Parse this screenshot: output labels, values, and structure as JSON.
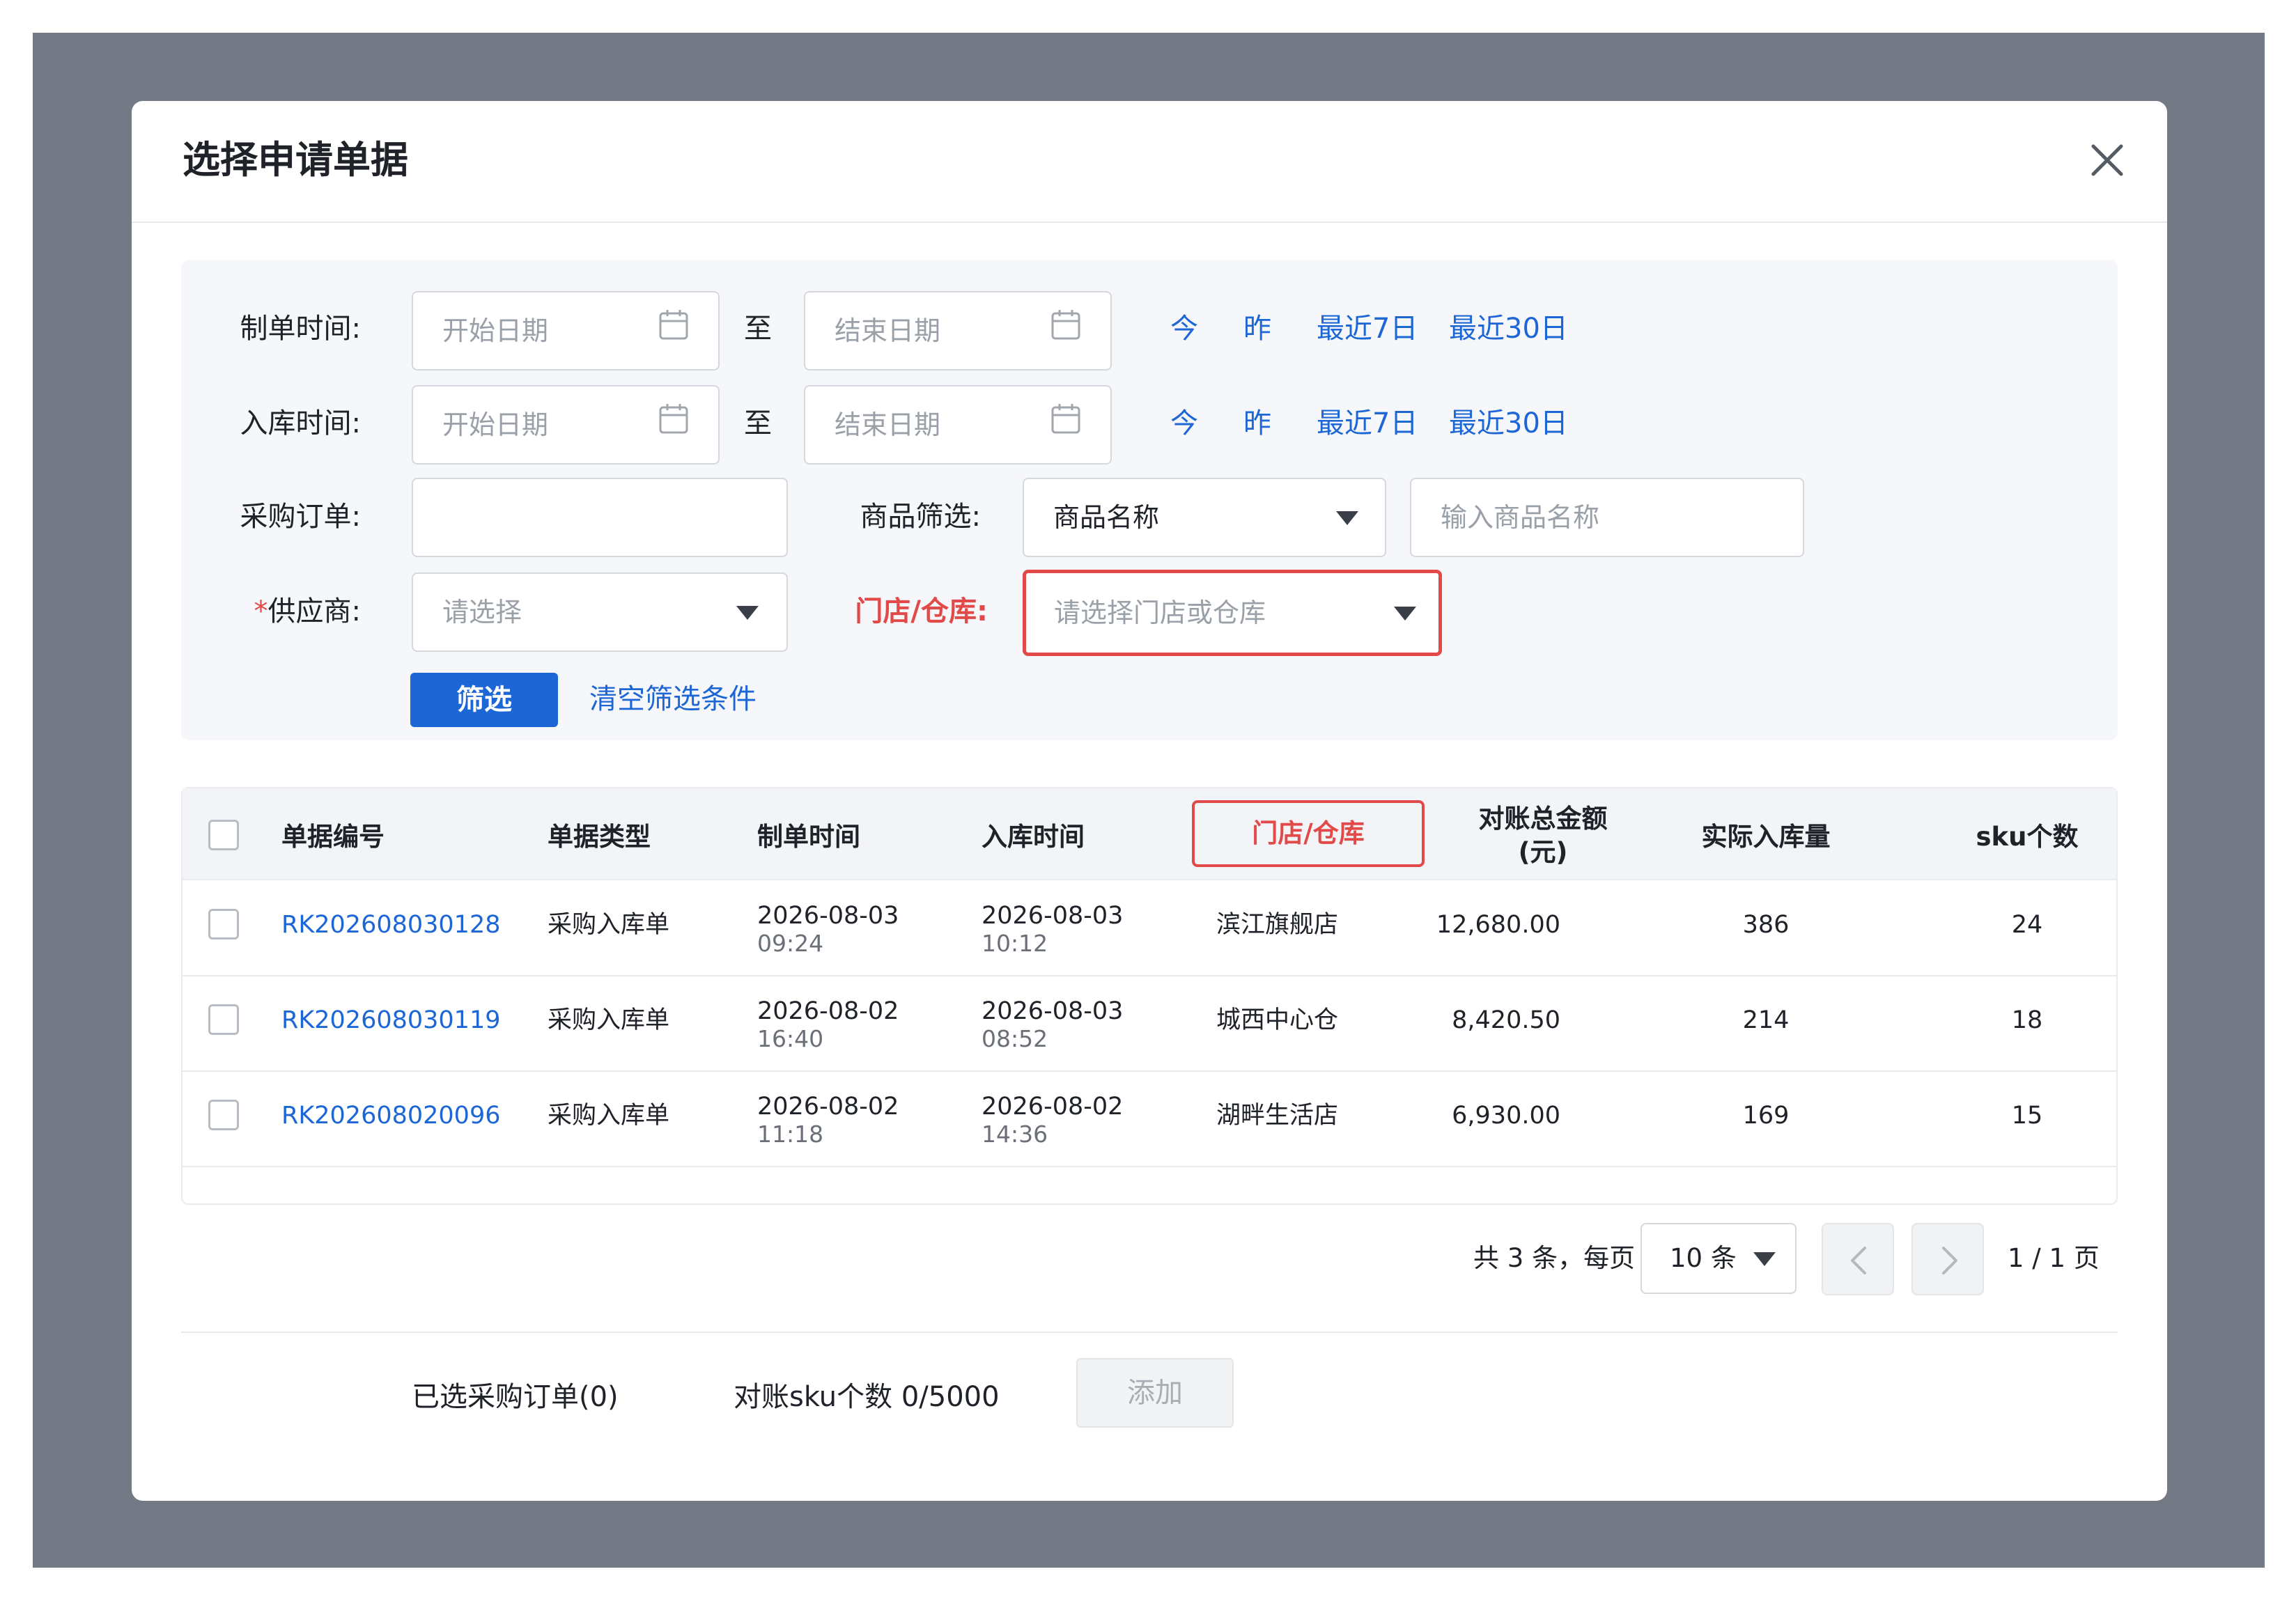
{
  "modal": {
    "title": "选择申请单据"
  },
  "filters": {
    "create_time": {
      "label": "制单时间:",
      "start_placeholder": "开始日期",
      "separator": "至",
      "end_placeholder": "结束日期",
      "quick": [
        "今",
        "昨",
        "最近7日",
        "最近30日"
      ]
    },
    "stock_time": {
      "label": "入库时间:",
      "start_placeholder": "开始日期",
      "separator": "至",
      "end_placeholder": "结束日期",
      "quick": [
        "今",
        "昨",
        "最近7日",
        "最近30日"
      ]
    },
    "purchase_order": {
      "label": "采购订单:",
      "value": ""
    },
    "product_filter": {
      "label": "商品筛选:",
      "type_value": "商品名称",
      "input_placeholder": "输入商品名称"
    },
    "supplier": {
      "required_mark": "*",
      "label": "供应商:",
      "placeholder": "请选择"
    },
    "store": {
      "label": "门店/仓库:",
      "placeholder": "请选择门店或仓库"
    },
    "filter_button": "筛选",
    "clear_link": "清空筛选条件"
  },
  "table": {
    "headers": {
      "doc_no": "单据编号",
      "doc_type": "单据类型",
      "create_time": "制单时间",
      "stock_time": "入库时间",
      "store": "门店/仓库",
      "amount_line1": "对账总金额",
      "amount_line2": "(元)",
      "actual_qty": "实际入库量",
      "sku_count": "sku个数"
    },
    "rows": [
      {
        "doc_no": "RK202608030128",
        "doc_type": "采购入库单",
        "create_date": "2026-08-03",
        "create_time": "09:24",
        "stock_date": "2026-08-03",
        "stock_time": "10:12",
        "store": "滨江旗舰店",
        "amount": "12,680.00",
        "actual_qty": "386",
        "sku_count": "24"
      },
      {
        "doc_no": "RK202608030119",
        "doc_type": "采购入库单",
        "create_date": "2026-08-02",
        "create_time": "16:40",
        "stock_date": "2026-08-03",
        "stock_time": "08:52",
        "store": "城西中心仓",
        "amount": "8,420.50",
        "actual_qty": "214",
        "sku_count": "18"
      },
      {
        "doc_no": "RK202608020096",
        "doc_type": "采购入库单",
        "create_date": "2026-08-02",
        "create_time": "11:18",
        "stock_date": "2026-08-02",
        "stock_time": "14:36",
        "store": "湖畔生活店",
        "amount": "6,930.00",
        "actual_qty": "169",
        "sku_count": "15"
      }
    ]
  },
  "pagination": {
    "total_text": "共 3 条，每页",
    "page_size": "10 条",
    "page_text": "1 / 1 页"
  },
  "footer": {
    "selected_text": "已选采购订单(0)",
    "sku_text": "对账sku个数 0/5000",
    "add_button": "添加"
  },
  "icons": {
    "close": "close-icon",
    "calendar": "calendar-icon",
    "dropdown": "caret-down-icon",
    "prev": "chevron-left-icon",
    "next": "chevron-right-icon"
  },
  "colors": {
    "primary": "#1d66d6",
    "error": "#e24a4a",
    "overlay": "#737a85"
  }
}
